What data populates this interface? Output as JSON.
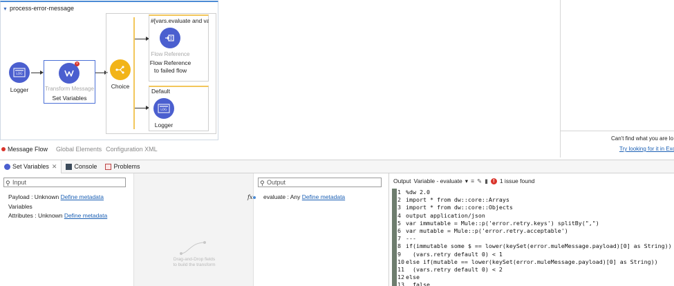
{
  "flow": {
    "title": "process-error-message",
    "nodes": {
      "logger": {
        "label": "Logger"
      },
      "transform": {
        "sub": "Transform Message",
        "label": "Set Variables"
      },
      "choice": {
        "label": "Choice"
      },
      "route1": {
        "header": "#[vars.evaluate and va...",
        "sub": "Flow Reference",
        "label_line1": "Flow Reference",
        "label_line2": "to failed flow"
      },
      "route2": {
        "header": "Default",
        "label": "Logger"
      }
    },
    "tabs": [
      "Message Flow",
      "Global Elements",
      "Configuration XML"
    ]
  },
  "hints": {
    "cant_find": "Can't find what you are lo",
    "try_link": "Try looking for it in Exc"
  },
  "panel_tabs": {
    "set_variables": "Set Variables",
    "console": "Console",
    "problems": "Problems"
  },
  "input": {
    "placeholder": "Input",
    "rows": [
      {
        "label": "Payload : Unknown",
        "link": "Define metadata"
      },
      {
        "label": "Variables",
        "link": ""
      },
      {
        "label": "Attributes : Unknown",
        "link": "Define metadata"
      }
    ]
  },
  "mid": {
    "drag_line1": "Drag-and-Drop fields",
    "drag_line2": "to build the transform"
  },
  "output": {
    "placeholder": "Output",
    "fx": "fx",
    "row_label": "evaluate : Any",
    "row_link": "Define metadata"
  },
  "script": {
    "output_label": "Output",
    "target": "Variable - evaluate",
    "issues": "1 issue found",
    "lines": [
      "%dw 2.0",
      "import * from dw::core::Arrays",
      "import * from dw::core::Objects",
      "output application/json",
      "var immutable = Mule::p('error.retry.keys') splitBy(\",\")",
      "var mutable = Mule::p('error.retry.acceptable')",
      "---",
      "if(immutable some $ == lower(keySet(error.muleMessage.payload)[0] as String))",
      "  (vars.retry default 0) < 1",
      "else if(mutable == lower(keySet(error.muleMessage.payload)[0] as String))",
      "  (vars.retry default 0) < 2",
      "else",
      "  false"
    ]
  },
  "colors": {
    "node_blue": "#4b5fcf",
    "choice_yellow": "#f2b418",
    "accent_blue": "#1a5fb4",
    "error_red": "#d9342b"
  }
}
